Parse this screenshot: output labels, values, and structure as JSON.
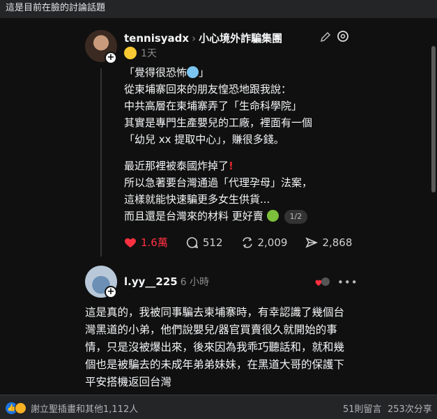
{
  "caption": "這是目前在臉的討論話題",
  "post": {
    "username": "tennisyadx",
    "community": "小心境外詐騙集團",
    "time": "1天",
    "lines_block1": [
      "「覺得很恐怖",
      "從柬埔寨回來的朋友惶恐地跟我說：",
      "中共高層在柬埔寨弄了「生命科學院」",
      "其實是專門生產嬰兒的工廠，裡面有一個",
      "「幼兒 xx 提取中心」，賺很多錢。"
    ],
    "line1_suffix": "」",
    "lines_block2": [
      "最近那裡被泰國炸掉了",
      "所以急著要台灣通過「代理孕母」法案，",
      "這樣就能快速騙更多女生供貨...",
      "而且還是台灣來的材料 更好賣"
    ],
    "page_badge": "1/2",
    "likes": "1.6萬",
    "replies": "512",
    "reposts": "2,009",
    "shares": "2,868"
  },
  "reply": {
    "username": "l.yy__225",
    "time": "6 小時",
    "text": "這是真的，我被同事騙去柬埔寨時，有幸認識了幾個台灣黑道的小弟，他們說嬰兒/器官買賣很久就開始的事情，只是沒被爆出來，後來因為我乖巧聽話和，就和幾個也是被騙去的未成年弟弟妹妹，在黑道大哥的保護下平安搭機返回台灣"
  },
  "footer": {
    "reactions_text": "謝立聖插畫和其他1,112人",
    "comments": "51則留言",
    "shares": "253次分享"
  },
  "colors": {
    "like": "#ff3040",
    "bg": "#101010",
    "fb_bar": "#242526"
  }
}
